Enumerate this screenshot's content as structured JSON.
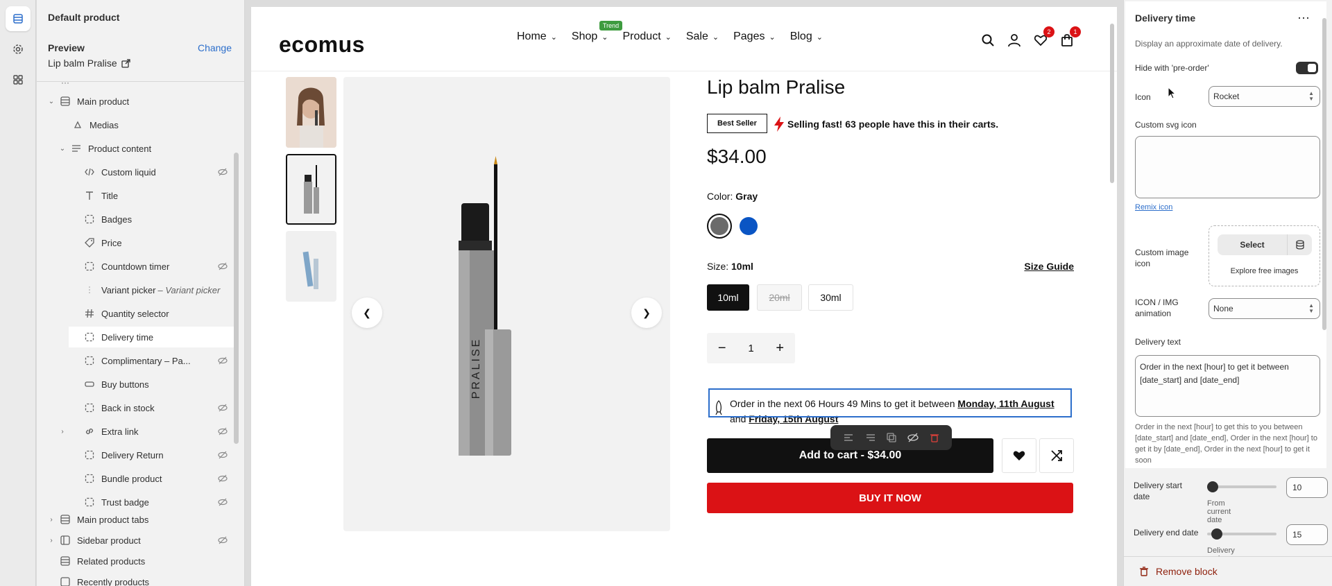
{
  "colors": {
    "accent": "#2c6ecb",
    "buy_now": "#db1215",
    "remove": "#8e1f0b"
  },
  "sidebar": {
    "title": "Default product",
    "preview_label": "Preview",
    "change_label": "Change",
    "preview_value": "Lip balm Pralise",
    "tree": {
      "main_product": "Main product",
      "medias": "Medias",
      "product_content": "Product content",
      "blocks": [
        {
          "label": "Custom liquid",
          "icon": "code-icon",
          "hidden": true
        },
        {
          "label": "Title",
          "icon": "title-icon",
          "hidden": false
        },
        {
          "label": "Badges",
          "icon": "block-icon",
          "hidden": false
        },
        {
          "label": "Price",
          "icon": "price-tag-icon",
          "hidden": false
        },
        {
          "label": "Countdown timer",
          "icon": "block-icon",
          "hidden": true
        },
        {
          "label": "Variant picker",
          "sub": "– Variant picker",
          "icon": "dots-icon",
          "hidden": false
        },
        {
          "label": "Quantity selector",
          "icon": "hash-icon",
          "hidden": false
        },
        {
          "label": "Delivery time",
          "icon": "block-icon",
          "hidden": false,
          "selected": true
        },
        {
          "label": "Complimentary – Pa...",
          "icon": "block-icon",
          "hidden": true
        },
        {
          "label": "Buy buttons",
          "icon": "button-icon",
          "hidden": false
        },
        {
          "label": "Back in stock",
          "icon": "block-icon",
          "hidden": true
        },
        {
          "label": "Extra link",
          "icon": "link-icon",
          "hidden": true
        },
        {
          "label": "Delivery Return",
          "icon": "block-icon",
          "hidden": true
        },
        {
          "label": "Bundle product",
          "icon": "block-icon",
          "hidden": true
        },
        {
          "label": "Trust badge",
          "icon": "block-icon",
          "hidden": true
        }
      ],
      "main_product_tabs": "Main product tabs",
      "sidebar_product": "Sidebar product",
      "related_products": "Related products",
      "recently_products": "Recently products"
    }
  },
  "store": {
    "logo": "ecomus",
    "nav": [
      "Home",
      "Shop",
      "Product",
      "Sale",
      "Pages",
      "Blog"
    ],
    "trend_badge": "Trend",
    "wishlist_count": "2",
    "cart_count": "1"
  },
  "product": {
    "title": "Lip balm Pralise",
    "badge": "Best Seller",
    "selling_fast": "Selling fast! 63 people have this in their carts.",
    "price": "$34.00",
    "color_label": "Color:",
    "color_value": "Gray",
    "swatches": [
      "#6b6b6b",
      "#0a55c4"
    ],
    "size_label": "Size:",
    "size_value": "10ml",
    "size_guide": "Size Guide",
    "sizes": [
      "10ml",
      "20ml",
      "30ml"
    ],
    "quantity": "1",
    "brand_on_tube": "PRALISE",
    "delivery": {
      "prefix": "Order in the next 06 Hours 49 Mins to get it between",
      "start": "Monday, 11th August",
      "and": "and",
      "end": "Friday, 15th August"
    },
    "add_to_cart": "Add to cart - $34.00",
    "buy_now": "BUY IT NOW"
  },
  "settings": {
    "title": "Delivery time",
    "description": "Display an approximate date of delivery.",
    "hide_preorder_label": "Hide with 'pre-order'",
    "icon_label": "Icon",
    "icon_value": "Rocket",
    "custom_svg_label": "Custom svg icon",
    "custom_svg_value": "",
    "remix_link": "Remix icon",
    "custom_image_label": "Custom image icon",
    "select_label": "Select",
    "explore_label": "Explore free images",
    "animation_label": "ICON / IMG animation",
    "animation_value": "None",
    "delivery_text_label": "Delivery text",
    "delivery_text_value": "Order in the next [hour] to get it between [date_start] and [date_end]",
    "help_text": "Order in the next [hour] to get this to you between [date_start] and [date_end], Order in the next [hour] to get it by [date_end], Order in the next [hour] to get it soon",
    "start_label": "Delivery start date",
    "start_value": "10",
    "start_sub": "From current date",
    "end_label": "Delivery end date",
    "end_value": "15",
    "end_sub": "Delivery end date",
    "remove_label": "Remove block"
  }
}
